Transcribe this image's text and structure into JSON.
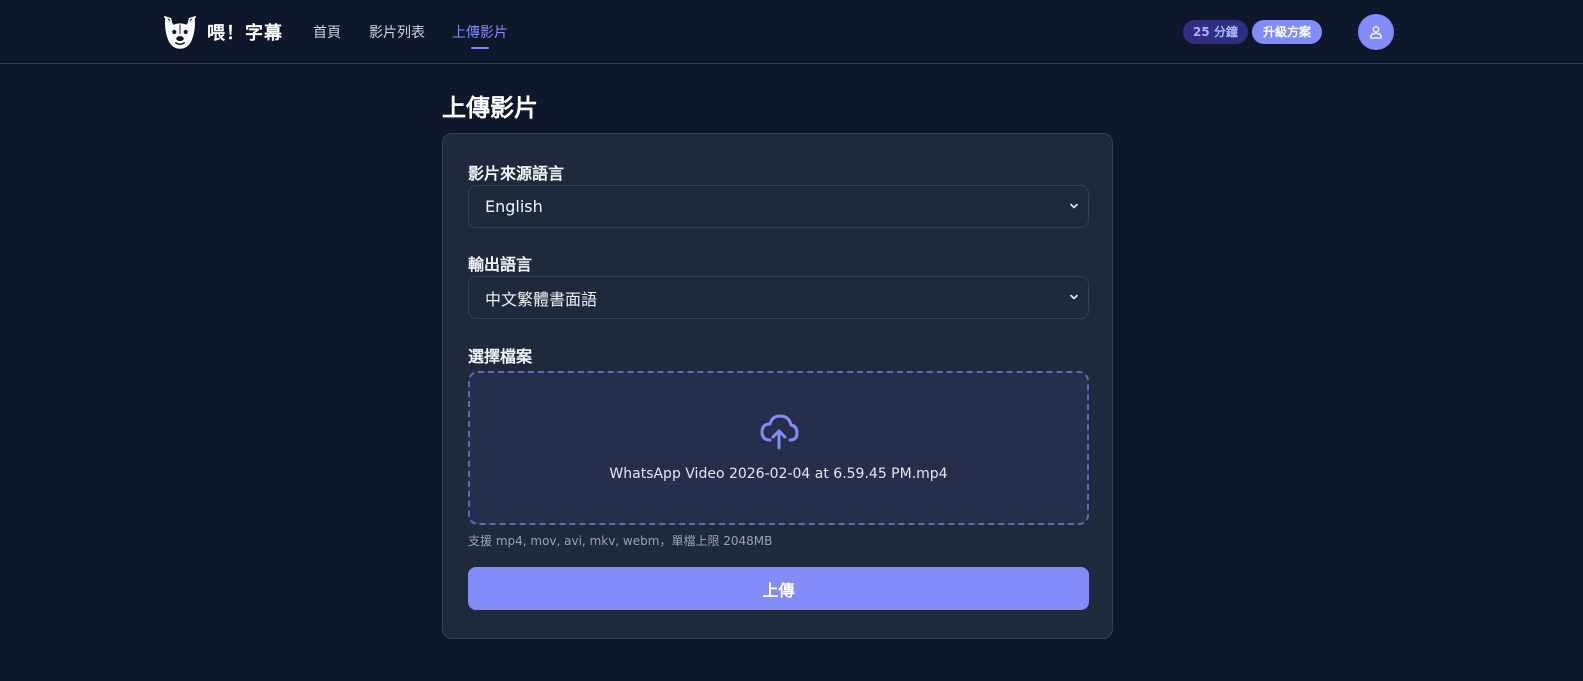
{
  "app": {
    "name": "喂！字幕"
  },
  "nav": {
    "items": [
      {
        "label": "首頁"
      },
      {
        "label": "影片列表"
      },
      {
        "label": "上傳影片",
        "active": true
      }
    ]
  },
  "account": {
    "minutes_badge": "25 分鐘",
    "upgrade_label": "升級方案",
    "avatar_icon": "user-icon"
  },
  "page": {
    "title": "上傳影片"
  },
  "form": {
    "source_language": {
      "label": "影片來源語言",
      "value": "English"
    },
    "output_language": {
      "label": "輸出語言",
      "value": "中文繁體書面語"
    },
    "file": {
      "label": "選擇檔案",
      "icon": "cloud-upload-icon",
      "selected_file": "WhatsApp Video 2026-02-04 at 6.59.45 PM.mp4",
      "hint": "支援 mp4, mov, avi, mkv, webm，單檔上限 2048MB"
    },
    "submit_label": "上傳"
  },
  "colors": {
    "background": "#0f172a",
    "card": "#1e293b",
    "accent": "#818cf8",
    "border": "#334155"
  }
}
